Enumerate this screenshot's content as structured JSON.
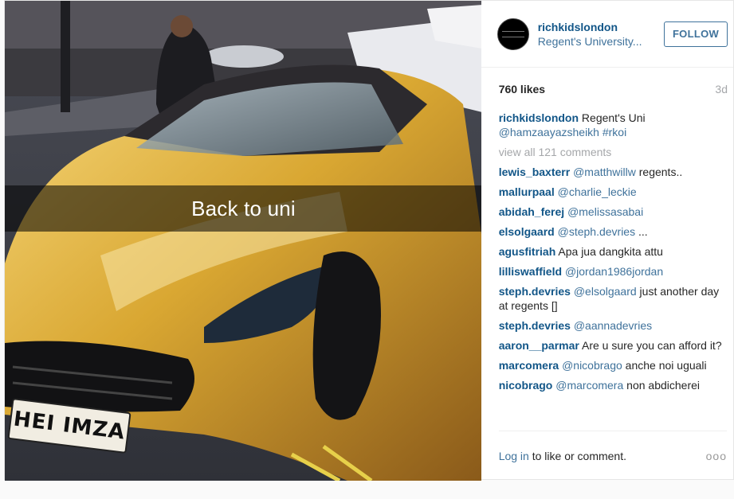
{
  "post": {
    "photo": {
      "caption_overlay": "Back to uni",
      "plate_text": "HEI IMZA"
    },
    "header": {
      "username": "richkidslondon",
      "location": "Regent's University...",
      "follow_label": "FOLLOW"
    },
    "likes": "760 likes",
    "time": "3d",
    "caption": {
      "user": "richkidslondon",
      "text": "Regent's Uni",
      "mention": "@hamzaayazsheikh",
      "hashtag": "#rkoi"
    },
    "view_all": "view all 121 comments",
    "comments": [
      {
        "user": "lewis_baxterr",
        "mention": "@matthwillw",
        "text": "regents.."
      },
      {
        "user": "mallurpaal",
        "mention": "@charlie_leckie",
        "text": ""
      },
      {
        "user": "abidah_ferej",
        "mention": "@melissasabai",
        "text": ""
      },
      {
        "user": "elsolgaard",
        "mention": "@steph.devries",
        "text": "..."
      },
      {
        "user": "agusfitriah",
        "mention": "",
        "text": "Apa jua dangkita attu"
      },
      {
        "user": "lilliswaffield",
        "mention": "@jordan1986jordan",
        "text": ""
      },
      {
        "user": "steph.devries",
        "mention": "@elsolgaard",
        "text": "just another day at regents []"
      },
      {
        "user": "steph.devries",
        "mention": "@aannadevries",
        "text": ""
      },
      {
        "user": "aaron__parmar",
        "mention": "",
        "text": "Are u sure you can afford it?"
      },
      {
        "user": "marcomera",
        "mention": "@nicobrago",
        "text": "anche noi uguali"
      },
      {
        "user": "nicobrago",
        "mention": "@marcomera",
        "text": "non abdicherei"
      }
    ],
    "footer": {
      "login_link": "Log in",
      "login_text": "to like or comment.",
      "more": "ooo"
    }
  }
}
